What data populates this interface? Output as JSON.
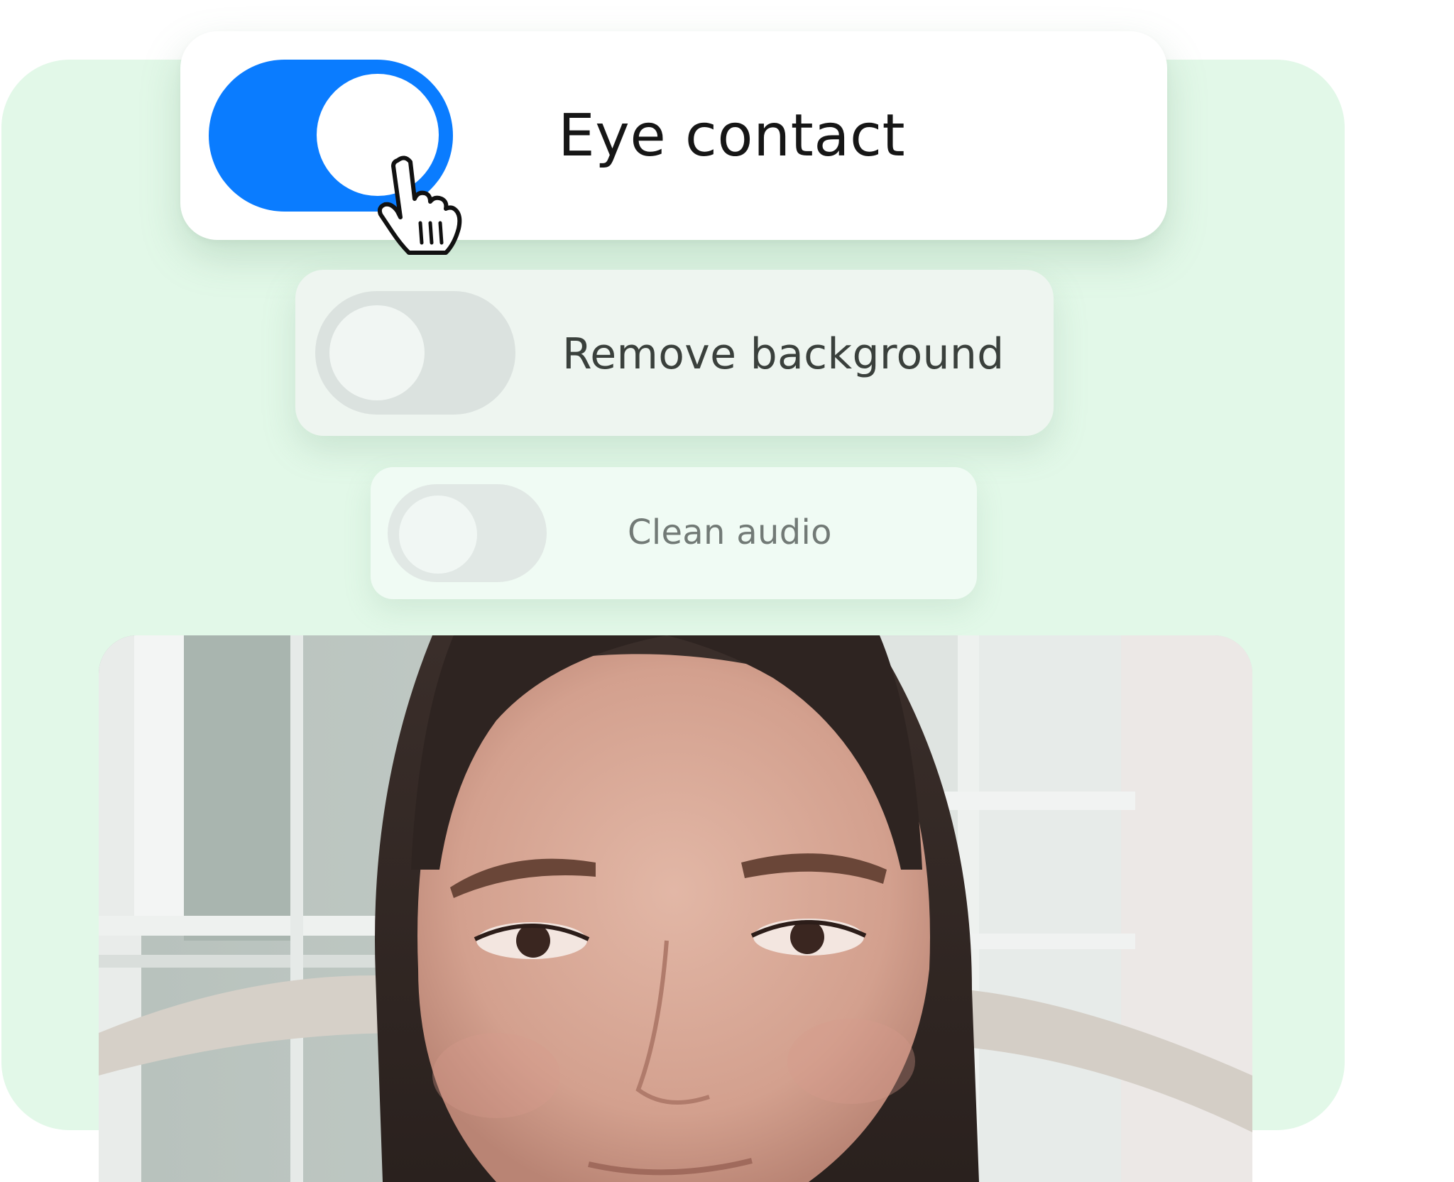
{
  "toggles": [
    {
      "label": "Eye contact",
      "state": "on"
    },
    {
      "label": "Remove background",
      "state": "off"
    },
    {
      "label": "Clean audio",
      "state": "off"
    }
  ],
  "colors": {
    "background_card": "#e2f8e8",
    "toggle_on": "#0a7cff",
    "toggle_off": "#dbe2df",
    "card_white": "#ffffff"
  },
  "icons": {
    "cursor": "hand-pointer-icon"
  },
  "video": {
    "content": "webcam-preview"
  }
}
